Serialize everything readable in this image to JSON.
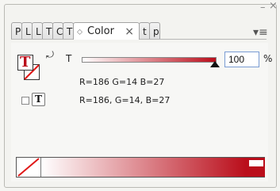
{
  "tabs": [
    {
      "label": "P"
    },
    {
      "label": "L"
    },
    {
      "label": "L"
    },
    {
      "label": "T"
    },
    {
      "label": "C"
    },
    {
      "label": "T"
    },
    {
      "label": "Color"
    },
    {
      "label": "t"
    },
    {
      "label": "p"
    }
  ],
  "active_tab": {
    "label": "Color",
    "close": "×"
  },
  "colors": {
    "accent": "#ba0e1b"
  },
  "tint": {
    "label": "T",
    "value": "100",
    "unit": "%"
  },
  "readouts": {
    "line1": "R=186 G=14 B=27",
    "line2": "R=186, G=14, B=27"
  },
  "buttons": {
    "text_mode": "T"
  },
  "window": {
    "minimize": "–",
    "close": "×"
  }
}
